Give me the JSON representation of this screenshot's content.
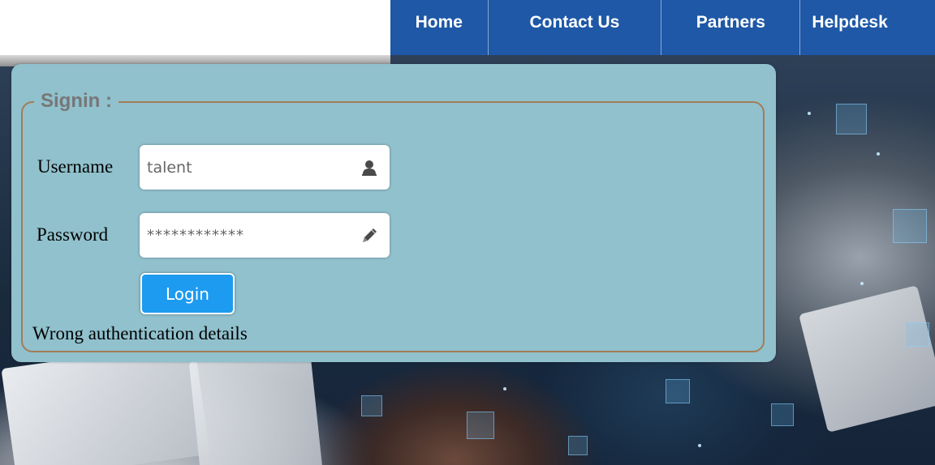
{
  "nav": {
    "items": [
      {
        "label": "Home"
      },
      {
        "label": "Contact Us"
      },
      {
        "label": "Partners"
      },
      {
        "label": "Helpdesk"
      }
    ]
  },
  "signin": {
    "legend": "Signin :",
    "username_label": "Username",
    "username_value": "talent",
    "username_icon": "user-icon",
    "password_label": "Password",
    "password_value": "************",
    "password_icon": "pencil-icon",
    "login_label": "Login",
    "error_message": "Wrong authentication details"
  },
  "colors": {
    "nav_bg": "#1e58a6",
    "panel_bg": "#90c1cd",
    "fieldset_border": "#a47c56",
    "button_bg": "#1d9bf0"
  }
}
